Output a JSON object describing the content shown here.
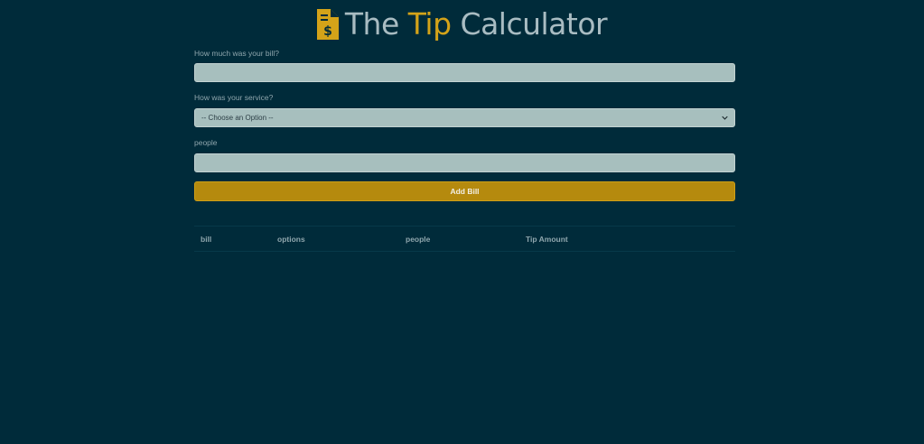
{
  "header": {
    "title_prefix": "The ",
    "title_accent": "Tip",
    "title_suffix": " Calculator",
    "accent_color": "#d4a319",
    "icon": "receipt-dollar-icon"
  },
  "form": {
    "bill_label": "How much was your bill?",
    "bill_value": "",
    "service_label": "How was your service?",
    "service_selected": "-- Choose an Option --",
    "people_label": "people",
    "people_value": "",
    "submit_label": "Add Bill",
    "submit_color": "#b58a0e"
  },
  "table": {
    "columns": [
      "bill",
      "options",
      "people",
      "Tip Amount"
    ],
    "rows": []
  },
  "colors": {
    "background": "#002b3a",
    "input_bg": "#a7bfbe"
  }
}
